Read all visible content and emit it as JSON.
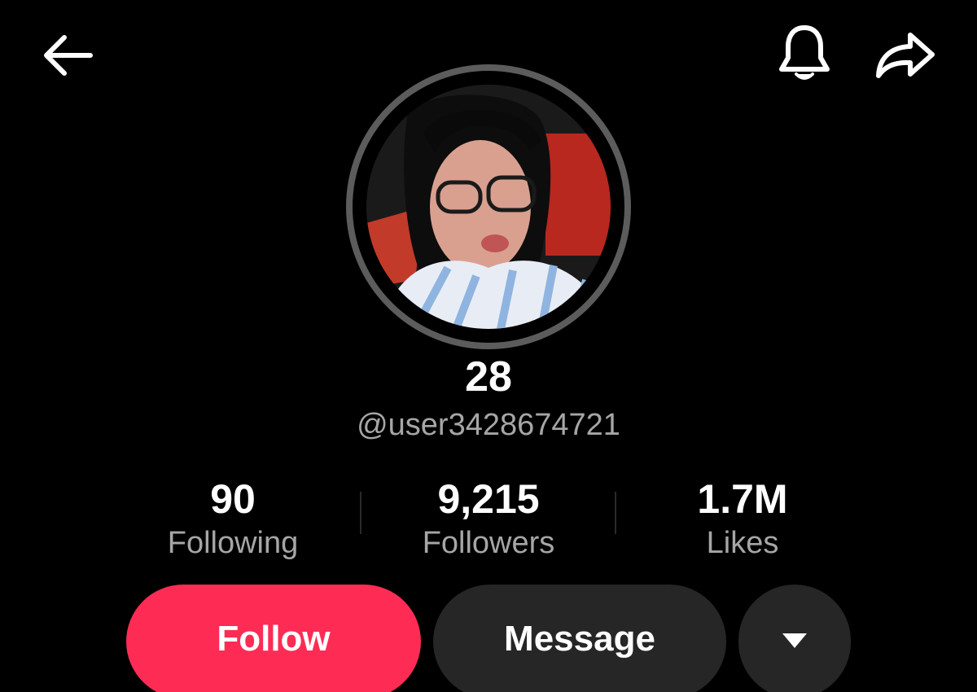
{
  "header": {
    "back_icon": "arrow-left-icon",
    "bell_icon": "bell-icon",
    "share_icon": "share-arrow-icon"
  },
  "profile": {
    "display_name": "28",
    "username": "@user3428674721"
  },
  "stats": {
    "following": {
      "value": "90",
      "label": "Following"
    },
    "followers": {
      "value": "9,215",
      "label": "Followers"
    },
    "likes": {
      "value": "1.7M",
      "label": "Likes"
    }
  },
  "actions": {
    "follow_label": "Follow",
    "message_label": "Message",
    "more_icon": "caret-down-icon"
  },
  "colors": {
    "background": "#000000",
    "accent": "#fe2c55",
    "secondary_button": "#262626",
    "muted_text": "#a6a6a6",
    "avatar_ring": "#5c5c5c"
  }
}
